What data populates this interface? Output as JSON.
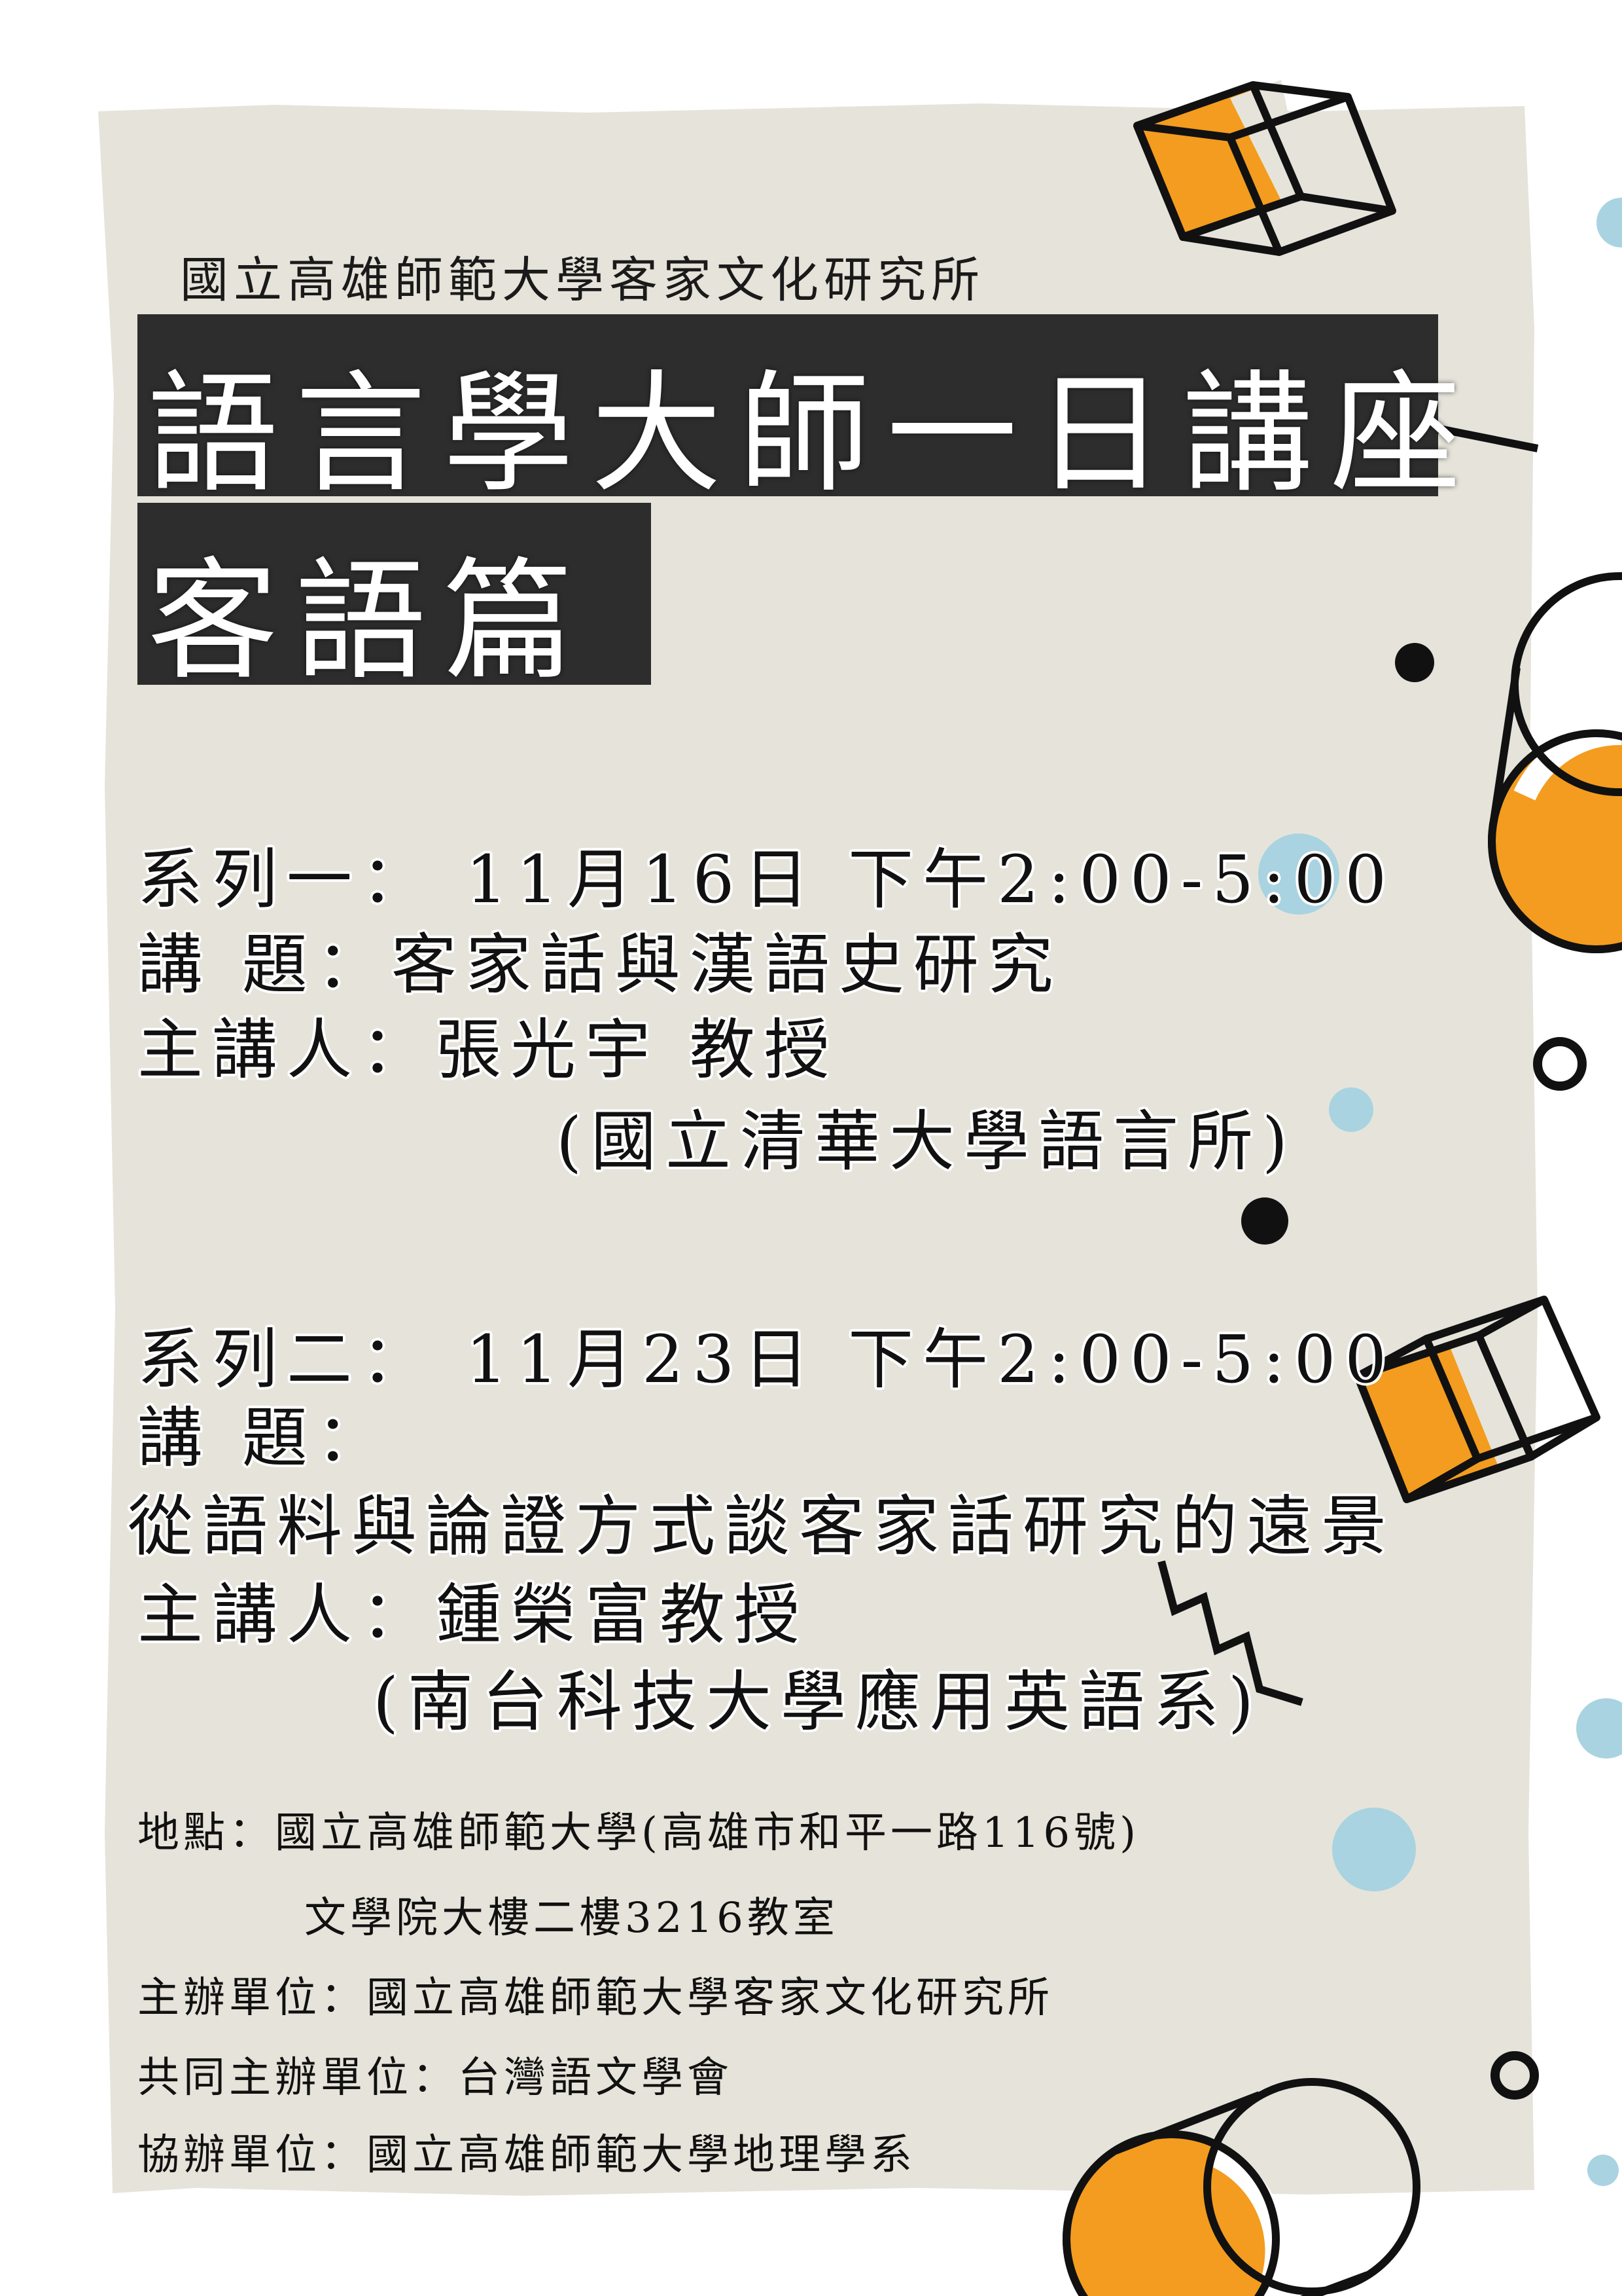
{
  "organizer_header": "國立高雄師範大學客家文化研究所",
  "title_line1": "語言學大師一日講座",
  "title_line2": "客語篇",
  "series1": {
    "line1": "系列一：  11月16日   下午2:00-5:00",
    "line2": "講   題：客家話與漢語史研究",
    "line3": "主講人：張光宇   教授",
    "line4": "(國立清華大學語言所)"
  },
  "series2": {
    "line1": "系列二：  11月23日   下午2:00-5:00",
    "line2": "講   題：",
    "line3": "從語料與論證方式談客家話研究的遠景",
    "line4": "主講人：鍾榮富教授",
    "line5": "(南台科技大學應用英語系)"
  },
  "footer": {
    "location": "地點：國立高雄師範大學(高雄市和平一路116號)",
    "location2": "文學院大樓二樓3216教室",
    "host": "主辦單位：國立高雄師範大學客家文化研究所",
    "cohost": "共同主辦單位：台灣語文學會",
    "assist": "協辦單位：國立高雄師範大學地理學系"
  },
  "colors": {
    "panel": "#e6e4da",
    "orange": "#f39c1f",
    "light_blue": "#a9d3e1",
    "dark_bar": "#2d2d2d"
  }
}
